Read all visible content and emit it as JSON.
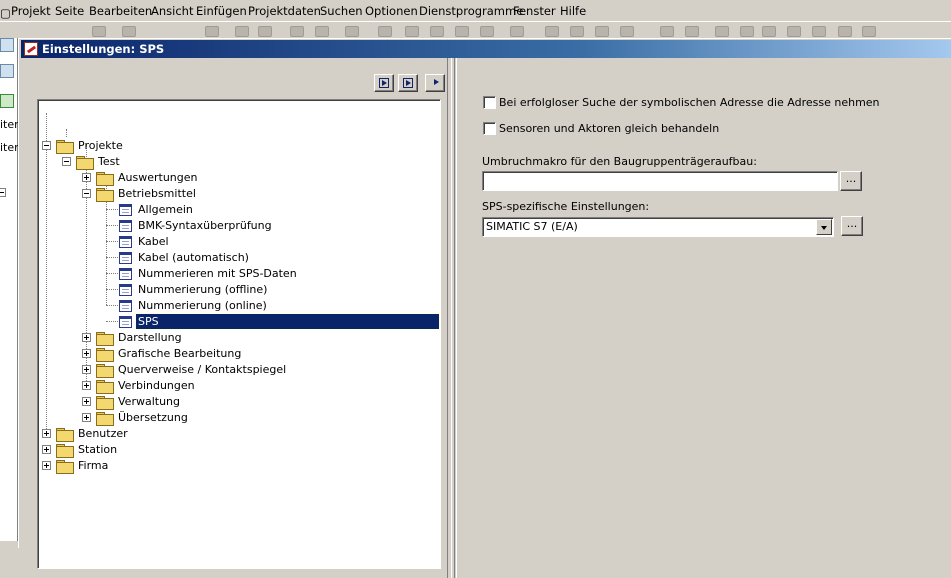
{
  "menubar": {
    "items": [
      {
        "label": "Projekt"
      },
      {
        "label": "Seite"
      },
      {
        "label": "Bearbeiten"
      },
      {
        "label": "Ansicht"
      },
      {
        "label": "Einfügen"
      },
      {
        "label": "Projektdaten"
      },
      {
        "label": "Suchen"
      },
      {
        "label": "Optionen"
      },
      {
        "label": "Dienstprogramme"
      },
      {
        "label": "Fenster"
      },
      {
        "label": "Hilfe"
      }
    ]
  },
  "background_window": {
    "labels": [
      "iter",
      "iter"
    ]
  },
  "dialog": {
    "title": "Einstellungen: SPS",
    "tree": {
      "nodes": [
        {
          "label": "Projekte",
          "kind": "folder",
          "expander": "minus",
          "selected": false
        },
        {
          "label": "Test",
          "kind": "folder",
          "expander": "minus",
          "selected": false
        },
        {
          "label": "Auswertungen",
          "kind": "folder",
          "expander": "plus",
          "selected": false
        },
        {
          "label": "Betriebsmittel",
          "kind": "folder",
          "expander": "minus",
          "selected": false
        },
        {
          "label": "Allgemein",
          "kind": "page",
          "expander": "none",
          "selected": false
        },
        {
          "label": "BMK-Syntaxüberprüfung",
          "kind": "page",
          "expander": "none",
          "selected": false
        },
        {
          "label": "Kabel",
          "kind": "page",
          "expander": "none",
          "selected": false
        },
        {
          "label": "Kabel (automatisch)",
          "kind": "page",
          "expander": "none",
          "selected": false
        },
        {
          "label": "Nummerieren mit SPS-Daten",
          "kind": "page",
          "expander": "none",
          "selected": false
        },
        {
          "label": "Nummerierung (offline)",
          "kind": "page",
          "expander": "none",
          "selected": false
        },
        {
          "label": "Nummerierung (online)",
          "kind": "page",
          "expander": "none",
          "selected": false
        },
        {
          "label": "SPS",
          "kind": "page",
          "expander": "none",
          "selected": true
        },
        {
          "label": "Darstellung",
          "kind": "folder",
          "expander": "plus",
          "selected": false
        },
        {
          "label": "Grafische Bearbeitung",
          "kind": "folder",
          "expander": "plus",
          "selected": false
        },
        {
          "label": "Querverweise / Kontaktspiegel",
          "kind": "folder",
          "expander": "plus",
          "selected": false
        },
        {
          "label": "Verbindungen",
          "kind": "folder",
          "expander": "plus",
          "selected": false
        },
        {
          "label": "Verwaltung",
          "kind": "folder",
          "expander": "plus",
          "selected": false
        },
        {
          "label": "Übersetzung",
          "kind": "folder",
          "expander": "plus",
          "selected": false
        },
        {
          "label": "Benutzer",
          "kind": "folder",
          "expander": "plus",
          "selected": false
        },
        {
          "label": "Station",
          "kind": "folder",
          "expander": "plus",
          "selected": false
        },
        {
          "label": "Firma",
          "kind": "folder",
          "expander": "plus",
          "selected": false
        }
      ]
    },
    "settings": {
      "checkbox1_label": "Bei erfolgloser Suche der symbolischen Adresse die Adresse nehmen",
      "checkbox1_checked": false,
      "checkbox2_label": "Sensoren und Aktoren gleich behandeln",
      "checkbox2_checked": false,
      "umbruch_label": "Umbruchmakro für den Baugruppenträgeraufbau:",
      "umbruch_value": "",
      "browse_label": "...",
      "sps_label": "SPS-spezifische Einstellungen:",
      "sps_value": "SIMATIC S7 (E/A)",
      "sps_browse_label": "..."
    }
  },
  "colors": {
    "selection": "#0a246a",
    "title_start": "#0a246a",
    "title_end": "#a6caf0",
    "face": "#d4d0c8"
  }
}
